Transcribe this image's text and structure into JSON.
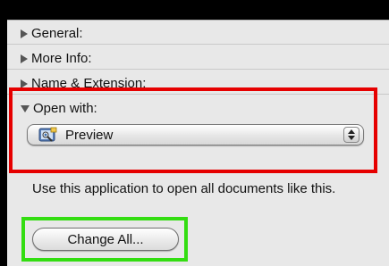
{
  "sections": [
    {
      "label": "General:",
      "expanded": false
    },
    {
      "label": "More Info:",
      "expanded": false
    },
    {
      "label": "Name & Extension:",
      "expanded": false
    },
    {
      "label": "Open with:",
      "expanded": true
    }
  ],
  "open_with": {
    "selected_app": "Preview",
    "app_icon": "preview-app-icon",
    "description": "Use this application to open all documents like this.",
    "change_all_label": "Change All..."
  },
  "highlights": {
    "red": "#e60000",
    "green": "#33dd11"
  }
}
